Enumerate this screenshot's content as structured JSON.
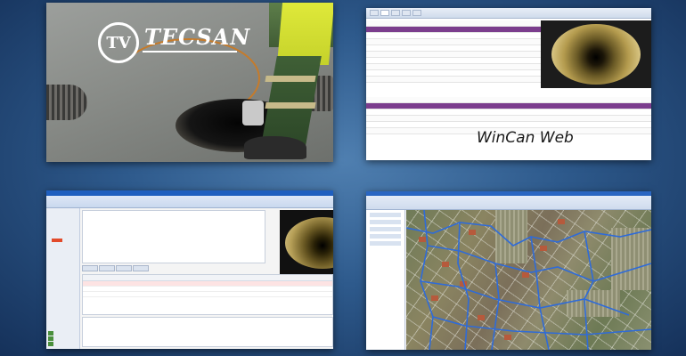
{
  "photo": {
    "logo_mark": "TV",
    "logo_name": "TECSAN"
  },
  "wincan_web": {
    "caption": "WinCan Web"
  },
  "icons": {
    "logo": "tv-circle-logo",
    "video": "pipe-camera-video"
  },
  "colors": {
    "background": "#2e5a8c",
    "highlight_row": "#7b3d8d",
    "brand_white": "#ffffff"
  }
}
